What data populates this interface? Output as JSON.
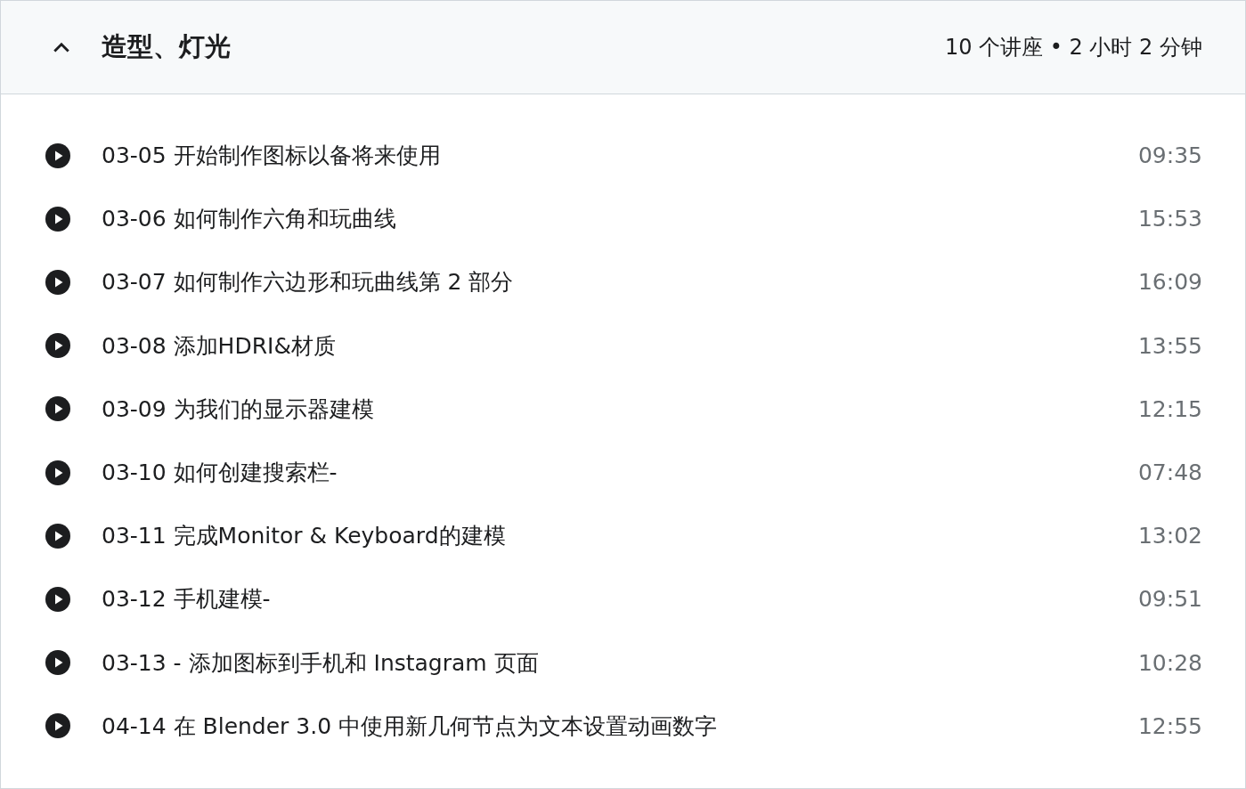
{
  "section": {
    "title": "造型、灯光",
    "expanded": true,
    "summary": "10 个讲座 • 2 小时 2 分钟"
  },
  "lectures": [
    {
      "title": "03-05 开始制作图标以备将来使用",
      "duration": "09:35"
    },
    {
      "title": "03-06 如何制作六角和玩曲线",
      "duration": "15:53"
    },
    {
      "title": "03-07 如何制作六边形和玩曲线第 2 部分",
      "duration": "16:09"
    },
    {
      "title": "03-08 添加HDRI&材质",
      "duration": "13:55"
    },
    {
      "title": "03-09 为我们的显示器建模",
      "duration": "12:15"
    },
    {
      "title": "03-10 如何创建搜索栏-",
      "duration": "07:48"
    },
    {
      "title": "03-11 完成Monitor & Keyboard的建模",
      "duration": "13:02"
    },
    {
      "title": "03-12 手机建模-",
      "duration": "09:51"
    },
    {
      "title": "03-13 - 添加图标到手机和 Instagram 页面",
      "duration": "10:28"
    },
    {
      "title": "04-14 在 Blender 3.0 中使用新几何节点为文本设置动画数字",
      "duration": "12:55"
    }
  ]
}
